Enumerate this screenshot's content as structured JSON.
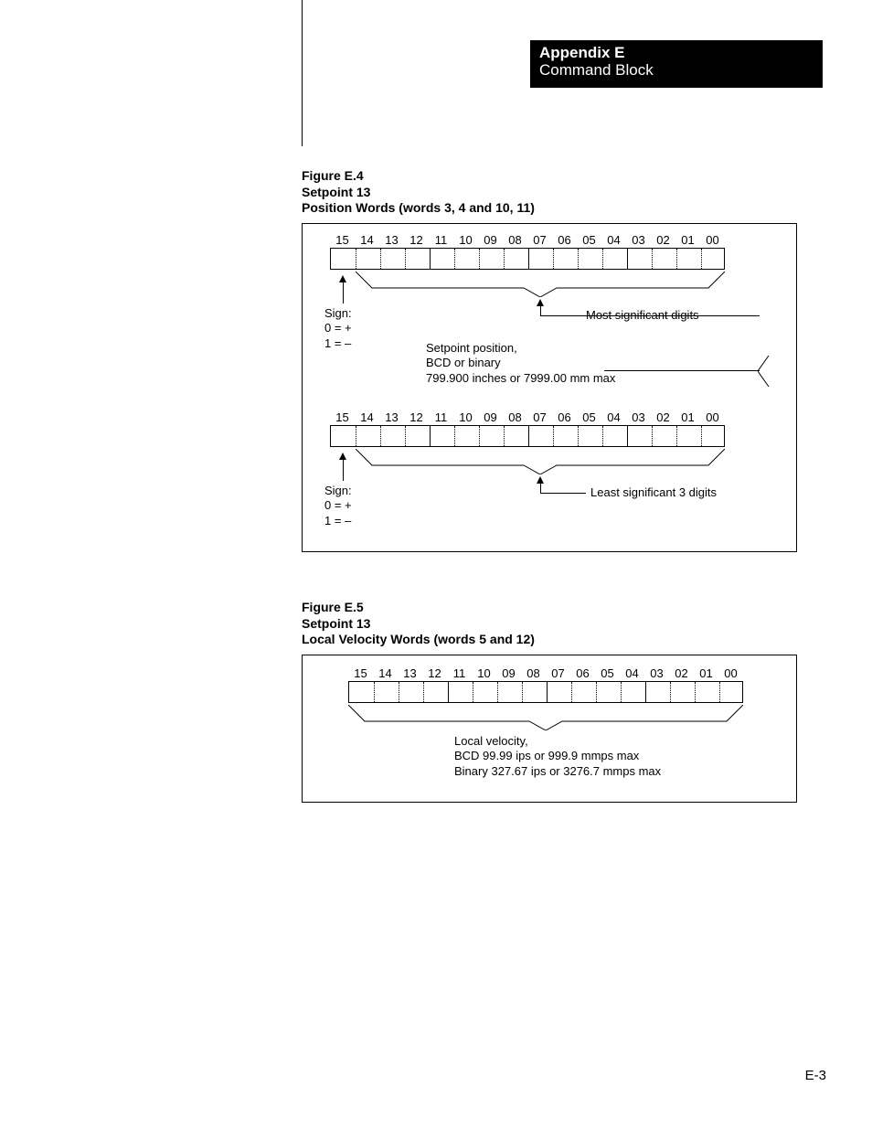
{
  "header": {
    "appendix": "Appendix E",
    "subtitle": "Command Block"
  },
  "figE4": {
    "line1": "Figure E.4",
    "line2": "Setpoint 13",
    "line3": "Position Words (words 3, 4 and 10, 11)",
    "bits": [
      "15",
      "14",
      "13",
      "12",
      "11",
      "10",
      "09",
      "08",
      "07",
      "06",
      "05",
      "04",
      "03",
      "02",
      "01",
      "00"
    ],
    "sign_line1": "Sign:",
    "sign_line2": "0 = +",
    "sign_line3": "1 = –",
    "msd": "Most significant digits",
    "lsd": "Least significant 3 digits",
    "mid1": "Setpoint position,",
    "mid2": "BCD or binary",
    "mid3": "799.900 inches or 7999.00 mm max"
  },
  "figE5": {
    "line1": "Figure E.5",
    "line2": "Setpoint 13",
    "line3": "Local Velocity Words (words 5 and 12)",
    "bits": [
      "15",
      "14",
      "13",
      "12",
      "11",
      "10",
      "09",
      "08",
      "07",
      "06",
      "05",
      "04",
      "03",
      "02",
      "01",
      "00"
    ],
    "c1": "Local velocity,",
    "c2": "BCD 99.99 ips or 999.9 mmps max",
    "c3": "Binary 327.67 ips or 3276.7 mmps max"
  },
  "page_num": "E-3"
}
